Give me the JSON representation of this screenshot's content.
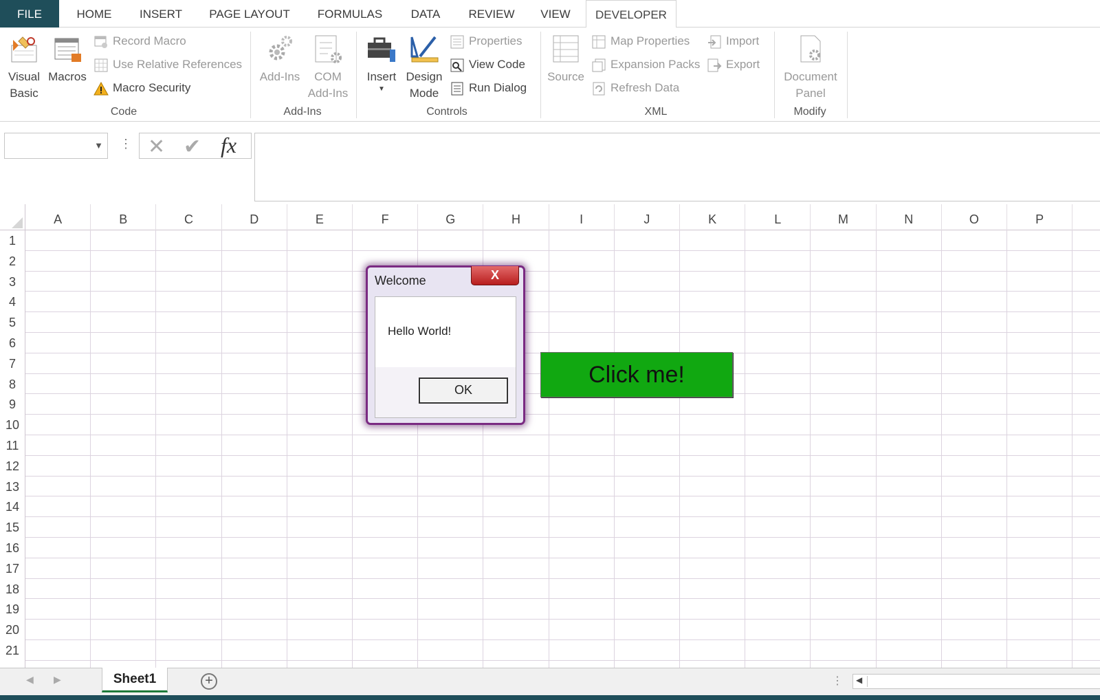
{
  "tabs": [
    "FILE",
    "HOME",
    "INSERT",
    "PAGE LAYOUT",
    "FORMULAS",
    "DATA",
    "REVIEW",
    "VIEW",
    "DEVELOPER"
  ],
  "ribbon": {
    "code": {
      "visual_basic": "Visual Basic",
      "visual_basic_line1": "Visual",
      "visual_basic_line2": "Basic",
      "macros": "Macros",
      "record_macro": "Record Macro",
      "use_relative": "Use Relative References",
      "macro_security": "Macro Security",
      "label": "Code"
    },
    "addins": {
      "addins": "Add-Ins",
      "com_line1": "COM",
      "com_line2": "Add-Ins",
      "label": "Add-Ins"
    },
    "controls": {
      "insert": "Insert",
      "design_line1": "Design",
      "design_line2": "Mode",
      "properties": "Properties",
      "view_code": "View Code",
      "run_dialog": "Run Dialog",
      "label": "Controls"
    },
    "xml": {
      "source": "Source",
      "map_properties": "Map Properties",
      "expansion_packs": "Expansion Packs",
      "refresh_data": "Refresh Data",
      "import": "Import",
      "export": "Export",
      "label": "XML"
    },
    "modify": {
      "doc_line1": "Document",
      "doc_line2": "Panel",
      "label": "Modify"
    }
  },
  "formula_bar": {
    "name_box": "",
    "formula": "",
    "fx": "fx"
  },
  "columns": [
    "A",
    "B",
    "C",
    "D",
    "E",
    "F",
    "G",
    "H",
    "I",
    "J",
    "K",
    "L",
    "M",
    "N",
    "O",
    "P"
  ],
  "rows": [
    "1",
    "2",
    "3",
    "4",
    "5",
    "6",
    "7",
    "8",
    "9",
    "10",
    "11",
    "12",
    "13",
    "14",
    "15",
    "16",
    "17",
    "18",
    "19",
    "20",
    "21"
  ],
  "button_shape": {
    "label": "Click me!",
    "color": "#11a811"
  },
  "dialog": {
    "title": "Welcome",
    "message": "Hello World!",
    "ok": "OK",
    "close": "X"
  },
  "sheets": {
    "active": "Sheet1",
    "add": "+"
  },
  "colors": {
    "file_tab": "#1f4e5a",
    "dialog_border": "#7a2a82"
  }
}
